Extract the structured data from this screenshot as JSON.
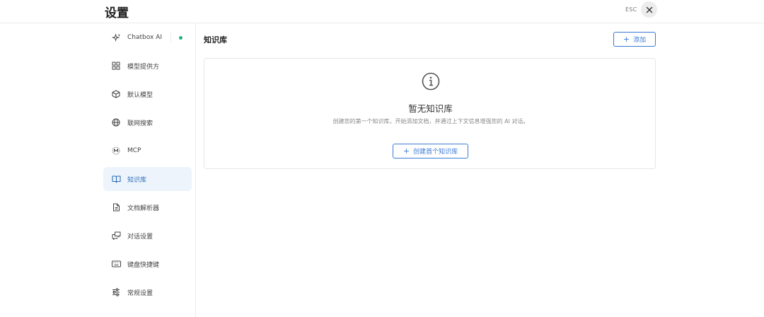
{
  "header": {
    "title": "设置",
    "esc_label": "ESC",
    "close_icon": "close-icon"
  },
  "sidebar": {
    "items": [
      {
        "label": "Chatbox AI",
        "icon": "sparkle-icon",
        "status_color": "#22b07d"
      },
      {
        "label": "模型提供方",
        "icon": "grid-icon"
      },
      {
        "label": "默认模型",
        "icon": "cube-icon"
      },
      {
        "label": "联网搜索",
        "icon": "globe-icon"
      },
      {
        "label": "MCP",
        "icon": "mcp-icon"
      },
      {
        "label": "知识库",
        "icon": "book-icon",
        "active": true
      },
      {
        "label": "文档解析器",
        "icon": "document-icon"
      },
      {
        "label": "对话设置",
        "icon": "chat-icon"
      },
      {
        "label": "键盘快捷键",
        "icon": "keyboard-icon"
      },
      {
        "label": "常规设置",
        "icon": "sliders-icon"
      }
    ]
  },
  "main": {
    "title": "知识库",
    "add_label": "添加",
    "empty": {
      "icon": "info-icon",
      "title": "暂无知识库",
      "description": "创建您的第一个知识库，开始添加文档，并通过上下文信息增强您的 AI 对话。",
      "create_label": "创建首个知识库"
    }
  },
  "colors": {
    "accent": "#3a7bd5",
    "active_bg": "#edf4fc",
    "status_green": "#22b07d"
  }
}
